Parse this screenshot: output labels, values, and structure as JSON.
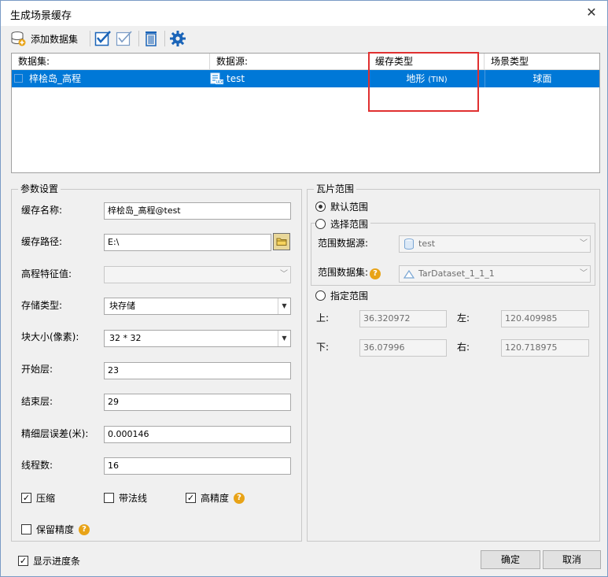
{
  "window": {
    "title": "生成场景缓存"
  },
  "toolbar": {
    "add_dataset_label": "添加数据集"
  },
  "grid": {
    "headers": [
      "数据集:",
      "数据源:",
      "缓存类型",
      "场景类型"
    ],
    "rows": [
      {
        "dataset": "梓桧岛_高程",
        "datasource": "test",
        "cache_type": "地形",
        "cache_type_suffix": "(TIN)",
        "scene_type": "球面"
      }
    ]
  },
  "params": {
    "legend": "参数设置",
    "cache_name_label": "缓存名称:",
    "cache_name_value": "梓桧岛_高程@test",
    "cache_path_label": "缓存路径:",
    "cache_path_value": "E:\\",
    "elevation_label": "高程特征值:",
    "storage_type_label": "存储类型:",
    "storage_type_value": "块存储",
    "block_size_label": "块大小(像素):",
    "block_size_value": "32 * 32",
    "start_level_label": "开始层:",
    "start_level_value": "23",
    "end_level_label": "结束层:",
    "end_level_value": "29",
    "fine_error_label": "精细层误差(米):",
    "fine_error_value": "0.000146",
    "threads_label": "线程数:",
    "threads_value": "16",
    "compress_label": "压缩",
    "normal_label": "带法线",
    "high_precision_label": "高精度",
    "keep_precision_label": "保留精度"
  },
  "tile_range": {
    "legend": "瓦片范围",
    "default_range_label": "默认范围",
    "select_range_label": "选择范围",
    "range_datasource_label": "范围数据源:",
    "range_datasource_value": "test",
    "range_dataset_label": "范围数据集:",
    "range_dataset_value": "TarDataset_1_1_1",
    "specify_range_label": "指定范围",
    "top_label": "上:",
    "top_value": "36.320972",
    "left_label": "左:",
    "left_value": "120.409985",
    "bottom_label": "下:",
    "bottom_value": "36.07996",
    "right_label": "右:",
    "right_value": "120.718975"
  },
  "footer": {
    "show_progress_label": "显示进度条",
    "ok_label": "确定",
    "cancel_label": "取消"
  },
  "colors": {
    "selection": "#0078d7",
    "highlight_box": "#e03030",
    "accent_icon": "#1a64b8",
    "help": "#e8a317"
  }
}
